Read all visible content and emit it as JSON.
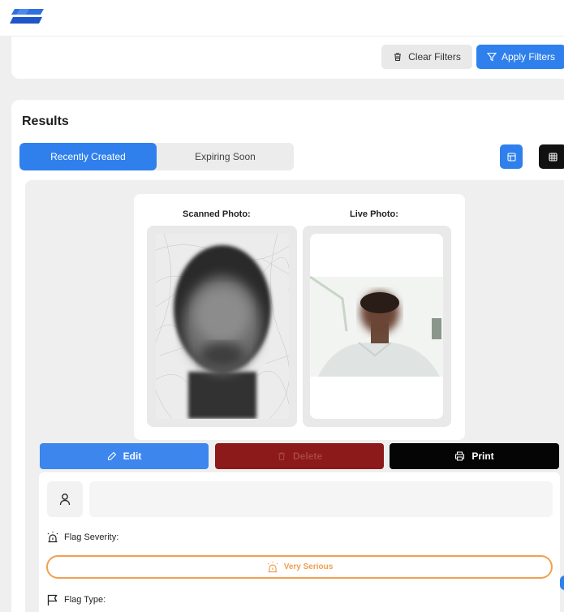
{
  "brand": {
    "logo_icon": "app-logo-icon",
    "accent": "#2f80ed"
  },
  "filters": {
    "clear_label": "Clear Filters",
    "clear_icon": "trash-icon",
    "apply_label": "Apply Filters",
    "apply_icon": "filter-icon"
  },
  "results": {
    "title": "Results",
    "tabs": [
      {
        "label": "Recently Created",
        "active": true
      },
      {
        "label": "Expiring Soon",
        "active": false
      }
    ],
    "view_toggle": [
      {
        "icon": "card-view-icon",
        "active": true
      },
      {
        "icon": "grid-view-icon",
        "active": false
      }
    ]
  },
  "record": {
    "scanned_label": "Scanned Photo:",
    "live_label": "Live Photo:",
    "actions": {
      "edit_label": "Edit",
      "edit_icon": "pencil-icon",
      "delete_label": "Delete",
      "delete_icon": "trash-icon",
      "print_label": "Print",
      "print_icon": "printer-icon"
    },
    "user_icon": "user-icon",
    "flag_severity_label": "Flag Severity:",
    "flag_severity_value": "Very Serious",
    "flag_severity_color": "#f0a050",
    "flag_type_label": "Flag Type:"
  }
}
